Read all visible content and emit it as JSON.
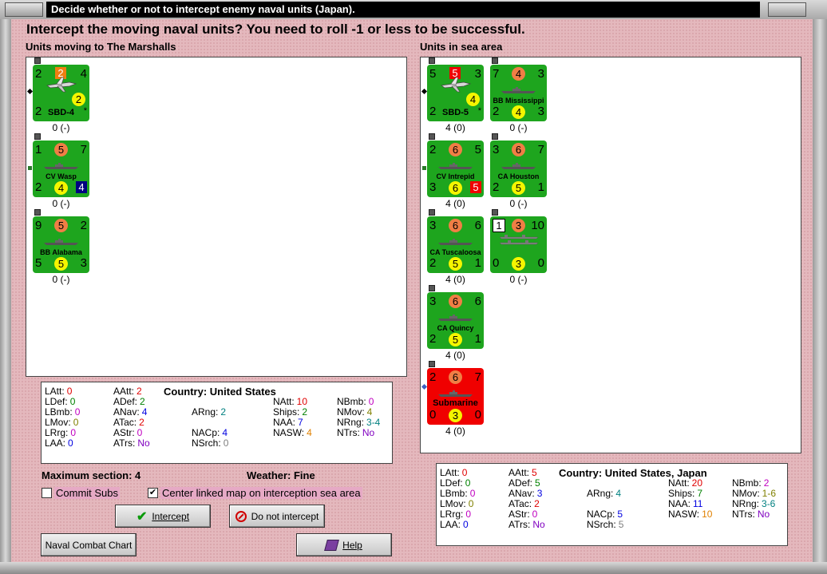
{
  "window": {
    "title": "Decide whether or not to intercept enemy naval units (Japan)."
  },
  "heading": "Intercept the moving naval units?  You need to roll -1 or less to be successful.",
  "left_panel": {
    "label": "Units moving to The Marshalls",
    "units": [
      {
        "name": "SBD-4",
        "tl": "2",
        "tm": "2",
        "tr": "4",
        "bl": "2",
        "bm": "2",
        "br": "*",
        "sub": "0 (-)",
        "kind": "plane"
      },
      {
        "name": "CV Wasp",
        "tl": "1",
        "tm": "5",
        "tr": "7",
        "bl": "2",
        "bm": "4",
        "br": "4",
        "sub": "0 (-)",
        "kind": "ship"
      },
      {
        "name": "BB Alabama",
        "tl": "9",
        "tm": "5",
        "tr": "2",
        "bl": "5",
        "bm": "5",
        "br": "3",
        "sub": "0 (-)",
        "kind": "ship"
      }
    ],
    "stats": {
      "latt": {
        "k": "LAtt:",
        "v": "0"
      },
      "ldef": {
        "k": "LDef:",
        "v": "0"
      },
      "lbmb": {
        "k": "LBmb:",
        "v": "0"
      },
      "lmov": {
        "k": "LMov:",
        "v": "0"
      },
      "lrng": {
        "k": "LRrg:",
        "v": "0"
      },
      "laa": {
        "k": "LAA:",
        "v": "0"
      },
      "aatt": {
        "k": "AAtt:",
        "v": "2"
      },
      "adef": {
        "k": "ADef:",
        "v": "2"
      },
      "anav": {
        "k": "ANav:",
        "v": "4"
      },
      "atac": {
        "k": "ATac:",
        "v": "2"
      },
      "astr": {
        "k": "AStr:",
        "v": "0"
      },
      "atrs": {
        "k": "ATrs:",
        "v": "No"
      },
      "country": {
        "k": "Country:",
        "v": "United States"
      },
      "arng": {
        "k": "ARng:",
        "v": "2"
      },
      "nacp": {
        "k": "NACp:",
        "v": "4"
      },
      "nsrch": {
        "k": "NSrch:",
        "v": "0"
      },
      "natt": {
        "k": "NAtt:",
        "v": "10"
      },
      "ships": {
        "k": "Ships:",
        "v": "2"
      },
      "naa": {
        "k": "NAA:",
        "v": "7"
      },
      "nasw": {
        "k": "NASW:",
        "v": "4"
      },
      "nbmb": {
        "k": "NBmb:",
        "v": "0"
      },
      "nmov": {
        "k": "NMov:",
        "v": "4"
      },
      "nrng": {
        "k": "NRng:",
        "v": "3-4"
      },
      "ntrs": {
        "k": "NTrs:",
        "v": "No"
      }
    }
  },
  "right_panel": {
    "label": "Units in sea area",
    "units": [
      {
        "name": "SBD-5",
        "tl": "5",
        "tm": "5",
        "tr": "3",
        "bl": "2",
        "bm": "4",
        "br": "*",
        "sub": "4 (0)",
        "kind": "plane",
        "tmsq": true
      },
      {
        "name": "BB Mississippi",
        "tl": "7",
        "tm": "4",
        "tr": "3",
        "bl": "2",
        "bm": "4",
        "br": "3",
        "sub": "0 (-)",
        "kind": "ship"
      },
      {
        "name": "CV Intrepid",
        "tl": "2",
        "tm": "6",
        "tr": "5",
        "bl": "3",
        "bm": "6",
        "br": "5",
        "sub": "4 (0)",
        "kind": "ship"
      },
      {
        "name": "CA Houston",
        "tl": "3",
        "tm": "6",
        "tr": "7",
        "bl": "2",
        "bm": "5",
        "br": "1",
        "sub": "0 (-)",
        "kind": "ship"
      },
      {
        "name": "CA Tuscaloosa",
        "tl": "3",
        "tm": "6",
        "tr": "6",
        "bl": "2",
        "bm": "5",
        "br": "1",
        "sub": "4 (0)",
        "kind": "ship"
      },
      {
        "name": "",
        "tl": "1",
        "tm": "3",
        "tr": "10",
        "bl": "0",
        "bm": "3",
        "br": "0",
        "sub": "0 (-)",
        "kind": "convoy"
      },
      {
        "name": "CA Quincy",
        "tl": "3",
        "tm": "6",
        "tr": "6",
        "bl": "2",
        "bm": "5",
        "br": "1",
        "sub": "4 (0)",
        "kind": "ship"
      },
      {
        "name": "Submarine",
        "tl": "2",
        "tm": "6",
        "tr": "7",
        "bl": "0",
        "bm": "3",
        "br": "0",
        "sub": "4 (0)",
        "kind": "sub"
      }
    ],
    "stats": {
      "latt": {
        "k": "LAtt:",
        "v": "0"
      },
      "ldef": {
        "k": "LDef:",
        "v": "0"
      },
      "lbmb": {
        "k": "LBmb:",
        "v": "0"
      },
      "lmov": {
        "k": "LMov:",
        "v": "0"
      },
      "lrng": {
        "k": "LRrg:",
        "v": "0"
      },
      "laa": {
        "k": "LAA:",
        "v": "0"
      },
      "aatt": {
        "k": "AAtt:",
        "v": "5"
      },
      "adef": {
        "k": "ADef:",
        "v": "5"
      },
      "anav": {
        "k": "ANav:",
        "v": "3"
      },
      "atac": {
        "k": "ATac:",
        "v": "2"
      },
      "astr": {
        "k": "AStr:",
        "v": "0"
      },
      "atrs": {
        "k": "ATrs:",
        "v": "No"
      },
      "country": {
        "k": "Country:",
        "v": "United States, Japan"
      },
      "arng": {
        "k": "ARng:",
        "v": "4"
      },
      "nacp": {
        "k": "NACp:",
        "v": "5"
      },
      "nsrch": {
        "k": "NSrch:",
        "v": "5"
      },
      "natt": {
        "k": "NAtt:",
        "v": "20"
      },
      "ships": {
        "k": "Ships:",
        "v": "7"
      },
      "naa": {
        "k": "NAA:",
        "v": "11"
      },
      "nasw": {
        "k": "NASW:",
        "v": "10"
      },
      "nbmb": {
        "k": "NBmb:",
        "v": "2"
      },
      "nmov": {
        "k": "NMov:",
        "v": "1-6"
      },
      "nrng": {
        "k": "NRng:",
        "v": "3-6"
      },
      "ntrs": {
        "k": "NTrs:",
        "v": "No"
      }
    }
  },
  "info": {
    "max_section": "Maximum section: 4",
    "weather": "Weather:  Fine"
  },
  "options": {
    "commit_subs": "Commit Subs",
    "center_map": "Center linked map on interception sea area",
    "check_mark": "✔"
  },
  "buttons": {
    "intercept": "Intercept",
    "do_not_intercept": "Do not intercept",
    "naval_combat_chart": "Naval Combat Chart",
    "help": "Help"
  },
  "colors": {
    "latt": "#e00000",
    "ldef": "#008000",
    "lbmb": "#c000c0",
    "lmov": "#808000",
    "lrng": "#c000c0",
    "laa": "#0000e0",
    "aatt": "#e00000",
    "adef": "#008000",
    "anav": "#0000e0",
    "atac": "#e00000",
    "astr": "#c000c0",
    "atrs": "#8000c0",
    "arng": "#008080",
    "nacp": "#0000e0",
    "nsrch": "#808080",
    "natt": "#e00000",
    "ships": "#008000",
    "naa": "#0000e0",
    "nasw": "#e08000",
    "nbmb": "#c000c0",
    "nmov": "#808000",
    "nrng": "#008080",
    "ntrs": "#8000c0"
  }
}
